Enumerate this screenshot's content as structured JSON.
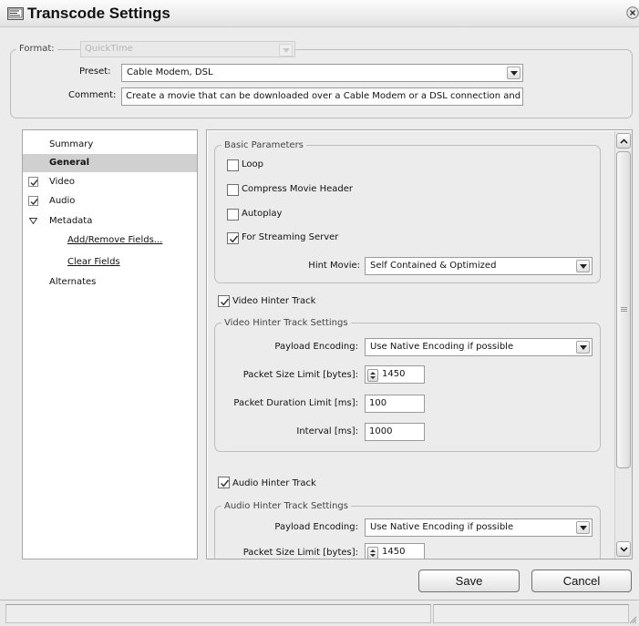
{
  "window": {
    "title": "Transcode Settings"
  },
  "format": {
    "label": "Format:",
    "value": "QuickTime"
  },
  "preset": {
    "label": "Preset:",
    "value": "Cable Modem, DSL"
  },
  "comment": {
    "label": "Comment:",
    "value": "Create a movie that can be downloaded over a Cable Modem or a DSL connection and play"
  },
  "sidebar": {
    "items": [
      {
        "label": "Summary"
      },
      {
        "label": "General"
      },
      {
        "label": "Video"
      },
      {
        "label": "Audio"
      },
      {
        "label": "Metadata"
      },
      {
        "label": "Add/Remove Fields..."
      },
      {
        "label": "Clear Fields"
      },
      {
        "label": "Alternates"
      }
    ]
  },
  "basic": {
    "legend": "Basic Parameters",
    "loop": "Loop",
    "compress": "Compress Movie Header",
    "autoplay": "Autoplay",
    "streaming": "For Streaming Server",
    "hint_label": "Hint Movie:",
    "hint_value": "Self Contained & Optimized"
  },
  "video": {
    "track_label": "Video Hinter Track",
    "legend": "Video Hinter Track Settings",
    "payload_label": "Payload Encoding:",
    "payload_value": "Use Native Encoding if possible",
    "packet_size_label": "Packet Size Limit [bytes]:",
    "packet_size_value": "1450",
    "duration_label": "Packet Duration Limit [ms]:",
    "duration_value": "100",
    "interval_label": "Interval [ms]:",
    "interval_value": "1000"
  },
  "audio": {
    "track_label": "Audio Hinter Track",
    "legend": "Audio Hinter Track Settings",
    "payload_label": "Payload Encoding:",
    "payload_value": "Use Native Encoding if possible",
    "packet_size_label": "Packet Size Limit [bytes]:",
    "packet_size_value": "1450"
  },
  "buttons": {
    "save": "Save",
    "cancel": "Cancel"
  },
  "colors": {
    "selected_row": "#d0d0d0",
    "panel_bg": "#ececec"
  }
}
